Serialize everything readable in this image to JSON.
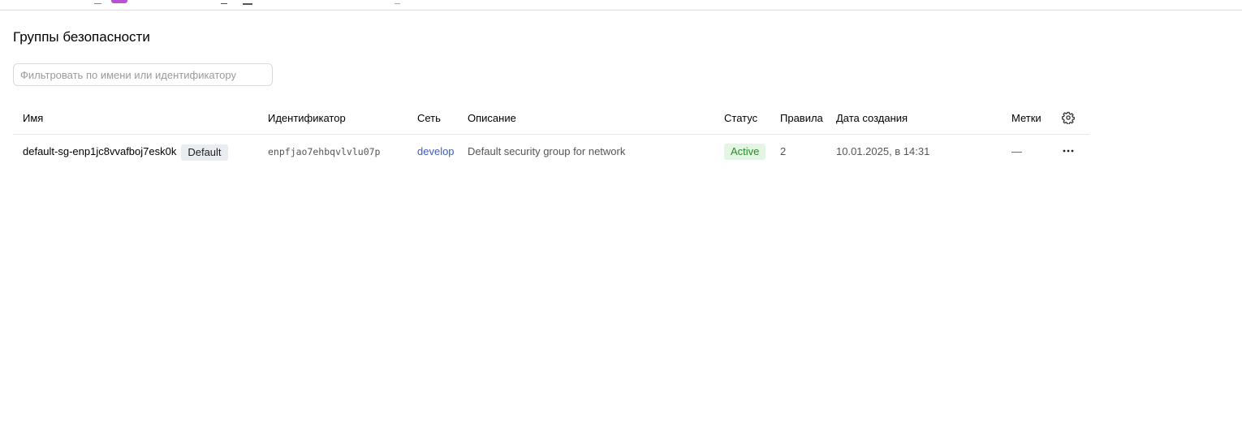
{
  "page": {
    "title": "Группы безопасности"
  },
  "filter": {
    "placeholder": "Фильтровать по имени или идентификатору",
    "value": ""
  },
  "table": {
    "columns": {
      "name": "Имя",
      "id": "Идентификатор",
      "network": "Сеть",
      "description": "Описание",
      "status": "Статус",
      "rules": "Правила",
      "created": "Дата создания",
      "labels": "Метки"
    },
    "settings_icon": "gear-icon",
    "more_icon": "more-horizontal-icon",
    "rows": [
      {
        "name": "default-sg-enp1jc8vvafboj7esk0k",
        "default_badge": "Default",
        "id": "enpfjao7ehbqvlvlu07p",
        "network": "develop",
        "description": "Default security group for network",
        "status": "Active",
        "rules": "2",
        "created": "10.01.2025, в 14:31",
        "labels": "—"
      }
    ]
  },
  "colors": {
    "link": "#3d5dbd",
    "status_active_bg": "#e4f5e4",
    "status_active_text": "#2a8a2a",
    "default_badge_bg": "#e9edf1",
    "border": "#e5e5e5"
  }
}
